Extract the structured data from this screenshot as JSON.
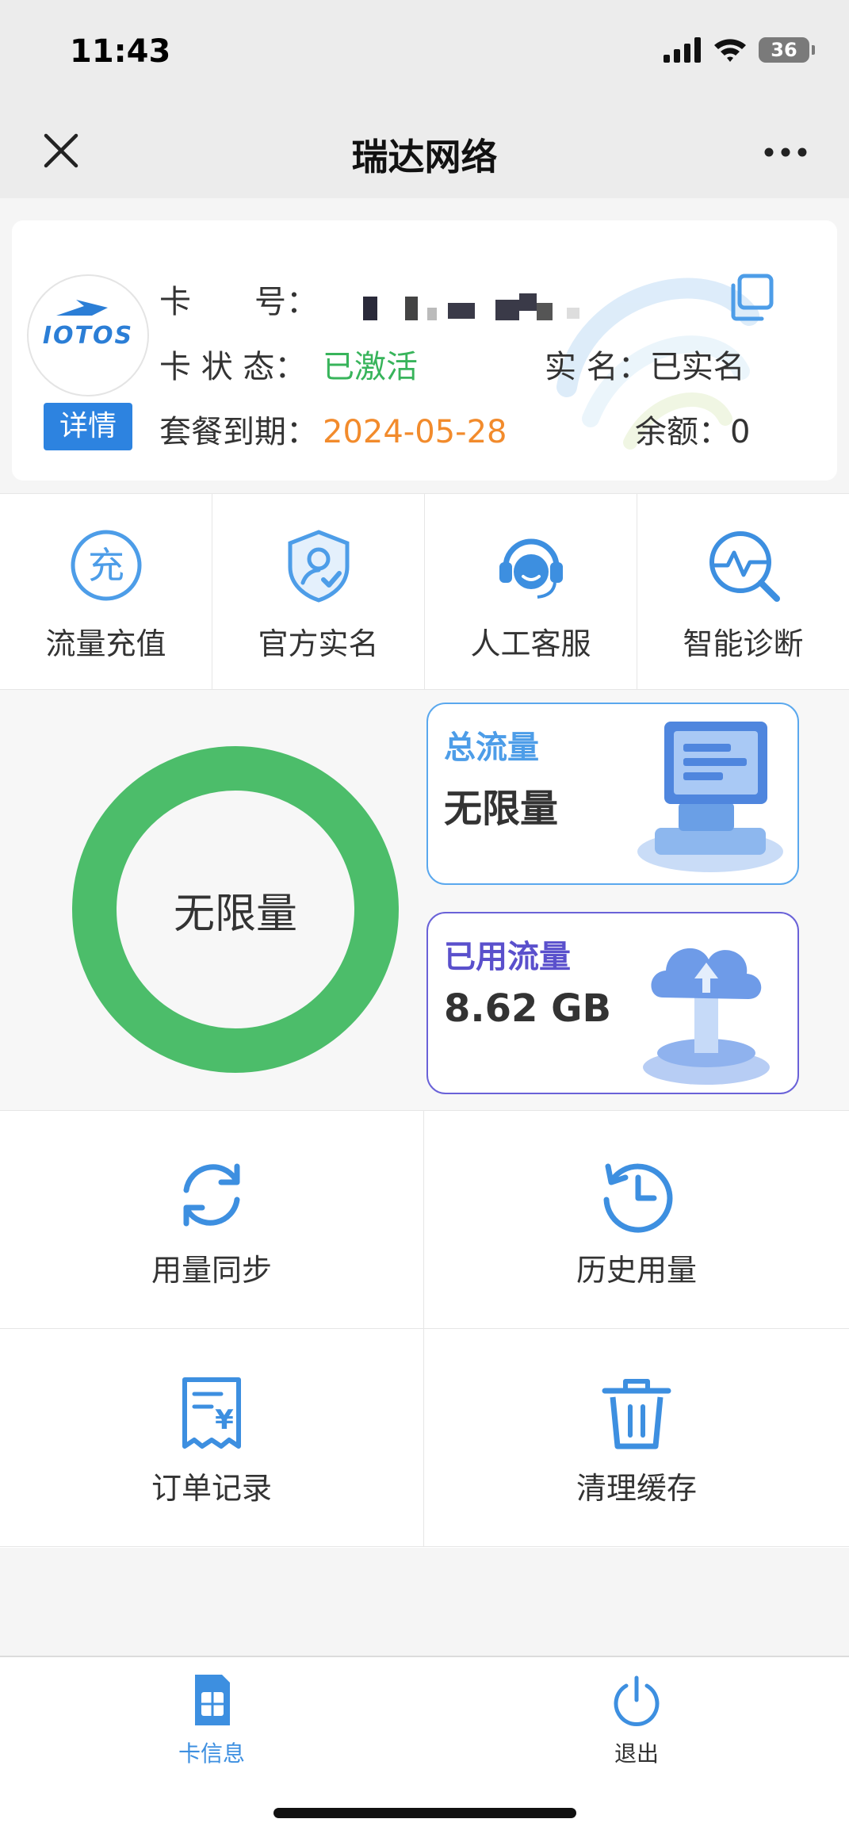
{
  "status_bar": {
    "time": "11:43",
    "battery": "36"
  },
  "nav": {
    "title": "瑞达网络"
  },
  "card": {
    "logo_text": "IOTOS",
    "detail_label": "详情",
    "card_no_label": "卡　　号：",
    "status_label": "卡 状 态：",
    "status_value": "已激活",
    "realname_label": "实  名：",
    "realname_value": "已实名",
    "expire_label": "套餐到期：",
    "expire_value": "2024-05-28",
    "balance_label": "余额：",
    "balance_value": "0"
  },
  "shortcuts": [
    {
      "label": "流量充值",
      "icon": "recharge-icon"
    },
    {
      "label": "官方实名",
      "icon": "shield-user-icon"
    },
    {
      "label": "人工客服",
      "icon": "customer-service-icon"
    },
    {
      "label": "智能诊断",
      "icon": "diagnose-icon"
    }
  ],
  "traffic": {
    "ring_text": "无限量",
    "ring_color": "#4cbd6a",
    "total_title": "总流量",
    "total_value": "无限量",
    "used_title": "已用流量",
    "used_value": "8.62 GB"
  },
  "actions": [
    {
      "label": "用量同步",
      "icon": "sync-icon"
    },
    {
      "label": "历史用量",
      "icon": "history-icon"
    },
    {
      "label": "订单记录",
      "icon": "order-receipt-icon"
    },
    {
      "label": "清理缓存",
      "icon": "trash-icon"
    }
  ],
  "tabbar": {
    "card_info": "卡信息",
    "logout": "退出",
    "active_color": "#3d8fe0"
  },
  "colors": {
    "accent": "#3d8fe0",
    "green": "#38b45b",
    "orange": "#f28b2c"
  }
}
